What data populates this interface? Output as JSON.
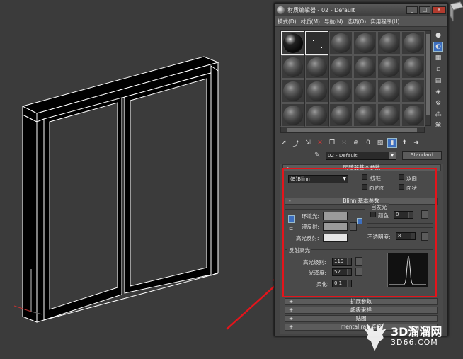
{
  "window": {
    "title": "材质编辑器 - 02 - Default",
    "minimize": "_",
    "maximize": "□",
    "close": "✕"
  },
  "menu": [
    "模式(D)",
    "材质(M)",
    "导航(N)",
    "选项(O)",
    "实用程序(U)"
  ],
  "material_name": "02 - Default",
  "material_type": "Standard",
  "shader_rollout": {
    "title": "明暗器基本参数",
    "shader": "(B)Blinn",
    "options": [
      "线框",
      "双面",
      "面贴图",
      "面状"
    ]
  },
  "blinn_rollout": {
    "title": "Blinn 基本参数",
    "self_illum_group": "自发光",
    "self_illum_color_label": "颜色",
    "self_illum_value": "0",
    "ambient_label": "环境光:",
    "diffuse_label": "漫反射:",
    "specular_label": "高光反射:",
    "opacity_label": "不透明度:",
    "opacity_value": "8",
    "specular_highlights_group": "反射高光",
    "spec_level_label": "高光级别:",
    "spec_level_value": "119",
    "glossiness_label": "光泽度:",
    "glossiness_value": "52",
    "soften_label": "柔化:",
    "soften_value": "0.1"
  },
  "collapsed_rollouts": [
    "扩展参数",
    "超级采样",
    "贴图",
    "mental ray 连接"
  ],
  "icons": {
    "tool_sample_type": "sphere-icon",
    "tool_backlight": "backlight-icon",
    "tool_background": "checker-icon"
  },
  "colors": {
    "highlight_red": "#e4141b",
    "tool_on": "#3d6fbf",
    "ambient_swatch": "#9a9a9a",
    "diffuse_swatch": "#9a9a9a",
    "specular_swatch": "#e6e6e6"
  },
  "watermark": {
    "title": "3D溜溜网",
    "url": "3D66.COM"
  }
}
